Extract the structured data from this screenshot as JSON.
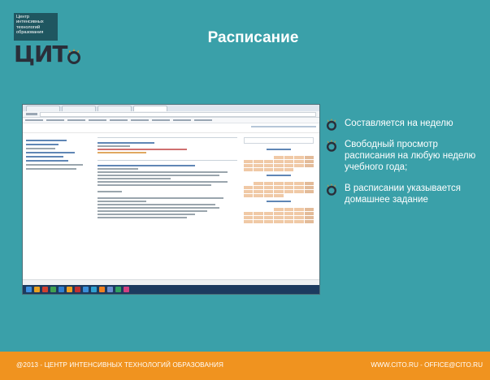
{
  "logo": {
    "lines": [
      "Центр",
      "интенсивных",
      "технологий",
      "образования"
    ],
    "mark": "ЦИТ",
    "sun_icon": "orange-sun-o-icon"
  },
  "slide": {
    "title": "Расписание"
  },
  "bullets": [
    "Составляется на неделю",
    "Свободный просмотр расписания на любую неделю учебного года;",
    "В расписании указывается домашнее задание"
  ],
  "bullet_icon": "orange-sun-bullet-icon",
  "footer": {
    "left": "@2013 - ЦЕНТР ИНТЕНСИВНЫХ ТЕХНОЛОГИЙ ОБРАЗОВАНИЯ",
    "right": "WWW.CITO.RU - OFFICE@CITO.RU"
  },
  "colors": {
    "background": "#3aa0a9",
    "footer": "#f0931f",
    "accent": "#f0931f"
  }
}
